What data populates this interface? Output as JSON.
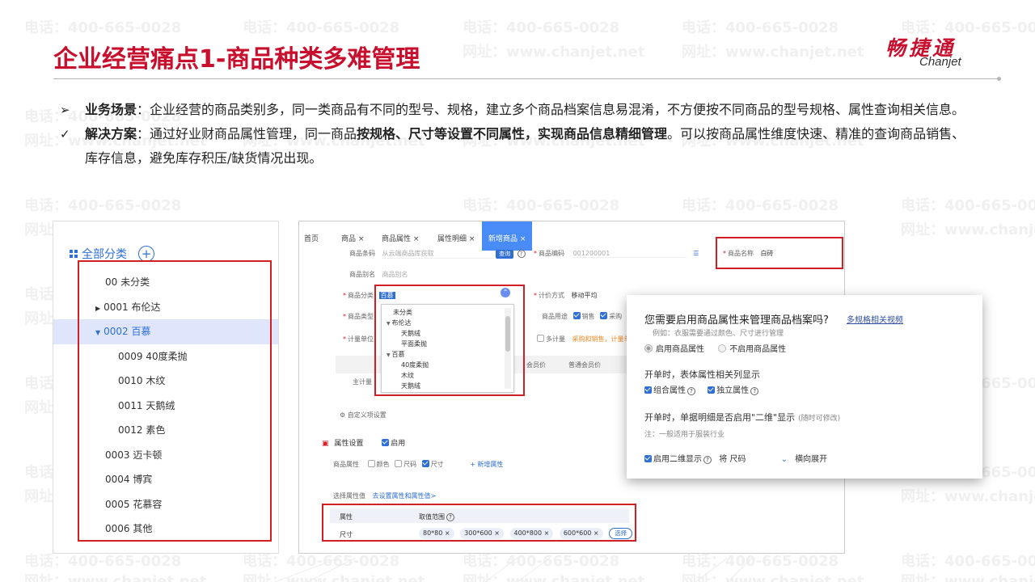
{
  "watermark": {
    "phone": "电话：400-665-0028",
    "site": "网址：www.chanjet.net"
  },
  "slide": {
    "title": "企业经营痛点1-商品种类多难管理"
  },
  "logo": {
    "cn": "畅捷通",
    "en": "Chanjet"
  },
  "bullets": {
    "scenario": {
      "label": "业务场景",
      "sep": "：",
      "text": "企业经营的商品类别多，同一类商品有不同的型号、规格，建立多个商品档案信息易混淆，不方便按不同商品的型号规格、属性查询相关信息。"
    },
    "solution": {
      "label": "解决方案",
      "sep": "：",
      "text_a": "通过好业财商品属性管理，同一商品",
      "text_bold": "按规格、尺寸等设置不同属性，实现商品信息精细管理",
      "text_b": "。可以按商品属性维度快速、精准的查询商品销售、库存信息，避免库存积压/缺货情况出现。"
    }
  },
  "category_tree": {
    "header": "全部分类",
    "items": [
      {
        "label": "00 未分类"
      },
      {
        "label": "0001 布伦达",
        "arrow": "▶"
      },
      {
        "label": "0002 百慕",
        "arrow": "▼"
      },
      {
        "label": "0009 40度柔抛"
      },
      {
        "label": "0010 木纹"
      },
      {
        "label": "0011 天鹅绒"
      },
      {
        "label": "0012 素色"
      },
      {
        "label": "0003 迈卡顿"
      },
      {
        "label": "0004 博宾"
      },
      {
        "label": "0005 花慕容"
      },
      {
        "label": "0006 其他"
      }
    ]
  },
  "form": {
    "tabs": [
      "首页",
      "商品 ×",
      "商品属性 ×",
      "属性明细 ×",
      "新增商品 ×"
    ],
    "barcode_label": "商品条码",
    "barcode_placeholder": "从云端商品库获取",
    "query_btn": "查询",
    "code_label": "商品编码",
    "code_value": "001200001",
    "name_label": "商品名称",
    "name_value": "白砖",
    "alias_label": "商品别名",
    "alias_placeholder": "商品别名",
    "category_label": "商品分类",
    "category_value": "百慕",
    "valuation_label": "计价方式",
    "valuation_value": "移动平均",
    "type_label": "商品类型",
    "usage_label": "商品用途",
    "usage_sales": "销售",
    "usage_purchase": "采购",
    "unit_label": "计量单位",
    "multi_unit": "多计量",
    "multi_unit_hint": "采购和销售，计量单",
    "member_price": "会员价",
    "normal_member_price": "普通会员价",
    "main_unit": "主计量",
    "custom_items": "自定义项设置",
    "attr_setting": "属性设置",
    "enable": "启用",
    "goods_attr": "商品属性",
    "attr_color": "颜色",
    "attr_size_code": "尺码",
    "attr_size": "尺寸",
    "add_attr": "+ 新增属性",
    "choose_attr_value": "选择属性值",
    "goto_attr": "去设置属性和属性值>",
    "attr_col": "属性",
    "range_col": "取值范围",
    "attr_row_name": "尺寸",
    "size_values": [
      "80*80 ×",
      "300*600 ×",
      "400*800 ×",
      "600*600 ×"
    ],
    "choose_btn": "选择"
  },
  "dropdown": {
    "items": [
      "未分类",
      "布伦达",
      "天鹅绒",
      "平面柔抛",
      "百慕",
      "40度柔抛",
      "木纹",
      "天鹅绒"
    ]
  },
  "dialog": {
    "question": "您需要启用商品属性来管理商品档案吗?",
    "video_link": "多规格相关视频",
    "example": "例如：衣服需要通过颜色、尺寸进行管理",
    "opt_enable": "启用商品属性",
    "opt_disable": "不启用商品属性",
    "bill_attr_title": "开单时，表体属性相关列显示",
    "combo_attr": "组合属性",
    "indep_attr": "独立属性",
    "qr_title": "开单时，单据明细是否启用\"二维\"显示",
    "qr_note": "(随时可修改)",
    "qr_hint": "注：一般适用于服装行业",
    "qr_enable": "启用二维显示",
    "qr_will": "将 尺码",
    "qr_expand": "横向展开"
  },
  "colors": {
    "accent_red": "#c8102e",
    "blue": "#2f6fd6",
    "tab_blue": "#4a8cf7",
    "highlight_box": "#d21f26"
  },
  "icons": [
    "grid-icon",
    "plus-circle-icon",
    "expand-arrow-icon",
    "collapse-arrow-icon",
    "checkbox-icon",
    "help-circle-icon",
    "chevron-down-icon"
  ]
}
